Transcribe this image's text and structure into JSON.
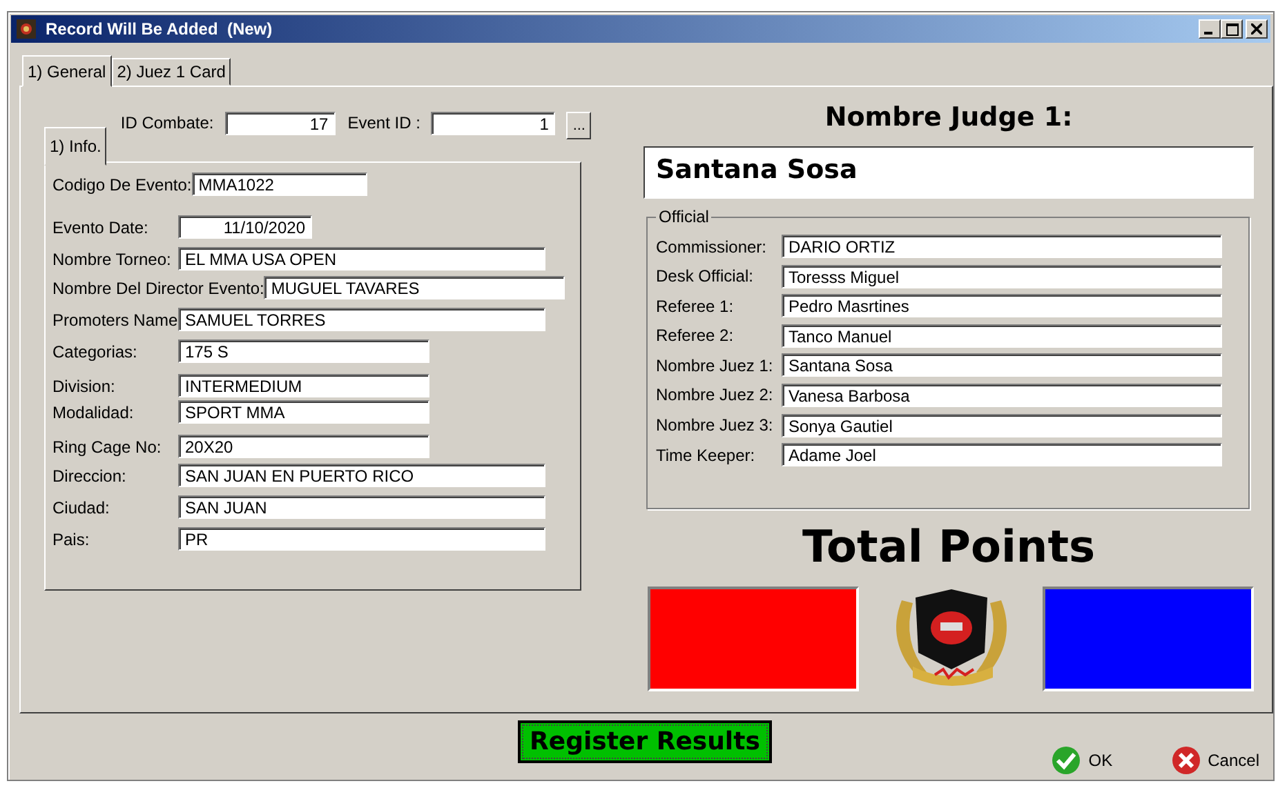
{
  "window": {
    "title": "Record Will Be Added  (New)"
  },
  "tabs": [
    {
      "label": "1) General",
      "selected": true
    },
    {
      "label": "2) Juez 1 Card",
      "selected": false
    }
  ],
  "inner_tabs": [
    {
      "label": "1) Info.",
      "selected": true
    }
  ],
  "id_combate": {
    "label": "ID Combate:",
    "value": "17"
  },
  "event_id": {
    "label": "Event ID :",
    "value": "1",
    "lookup": "..."
  },
  "event_fields": [
    {
      "label": "Codigo De Evento:",
      "value": "MMA1022"
    },
    {
      "label": "Evento Date:",
      "value": "11/10/2020"
    },
    {
      "label": "Nombre Torneo:",
      "value": "EL MMA USA OPEN"
    },
    {
      "label": "Nombre Del Director Evento:",
      "value": "MUGUEL TAVARES"
    },
    {
      "label": "Promoters Name",
      "value": "SAMUEL TORRES"
    },
    {
      "label": "Categorias:",
      "value": "175 S"
    },
    {
      "label": "Division:",
      "value": "INTERMEDIUM"
    },
    {
      "label": "Modalidad:",
      "value": "SPORT MMA"
    },
    {
      "label": "Ring Cage No:",
      "value": "20X20"
    },
    {
      "label": "Direccion:",
      "value": "SAN JUAN EN PUERTO RICO"
    },
    {
      "label": "Ciudad:",
      "value": "SAN JUAN"
    },
    {
      "label": "Pais:",
      "value": "PR"
    }
  ],
  "judge": {
    "heading": "Nombre Judge 1:",
    "name": "Santana Sosa"
  },
  "official": {
    "title": "Official",
    "fields": [
      {
        "label": "Commissioner:",
        "value": "DARIO ORTIZ"
      },
      {
        "label": "Desk Official:",
        "value": "Toresss Miguel"
      },
      {
        "label": "Referee 1:",
        "value": "Pedro Masrtines"
      },
      {
        "label": "Referee 2:",
        "value": "Tanco Manuel"
      },
      {
        "label": "Nombre Juez 1:",
        "value": "Santana Sosa"
      },
      {
        "label": "Nombre Juez 2:",
        "value": "Vanesa Barbosa"
      },
      {
        "label": "Nombre Juez 3:",
        "value": "Sonya Gautiel"
      },
      {
        "label": "Time Keeper:",
        "value": "Adame Joel"
      }
    ]
  },
  "totals": {
    "title": "Total Points",
    "corners": [
      {
        "color": "#ff0000"
      },
      {
        "color": "#0000ff"
      }
    ]
  },
  "buttons": {
    "register": "Register Results",
    "ok": "OK",
    "cancel": "Cancel"
  }
}
